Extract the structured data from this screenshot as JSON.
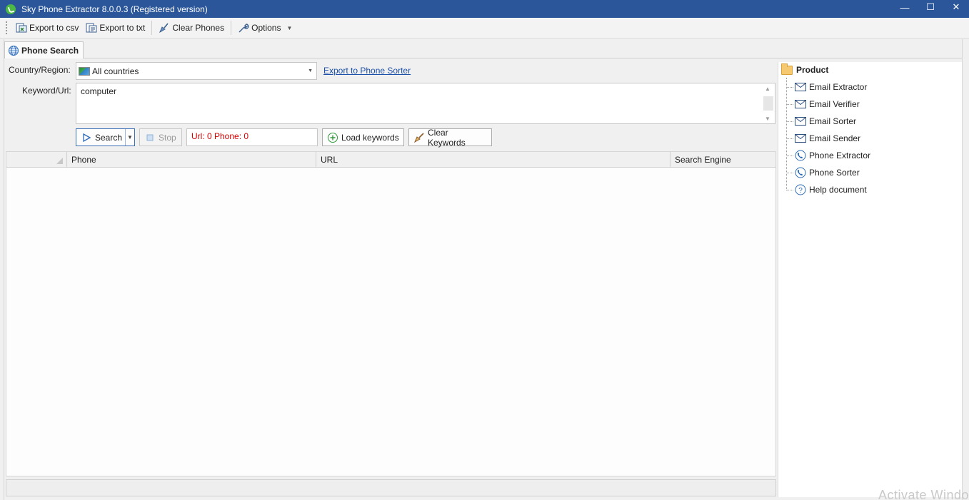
{
  "window": {
    "title": "Sky Phone Extractor 8.0.0.3 (Registered version)",
    "minimize": "—",
    "maximize": "☐",
    "close": "✕"
  },
  "toolbar": {
    "export_csv": "Export to csv",
    "export_txt": "Export to txt",
    "clear_phones": "Clear Phones",
    "options": "Options"
  },
  "tab": {
    "label": "Phone Search"
  },
  "form": {
    "country_label": "Country/Region:",
    "country_value": "All countries",
    "export_link": "Export to Phone Sorter",
    "keyword_label": "Keyword/Url:",
    "keyword_value": "computer",
    "search": "Search",
    "stop": "Stop",
    "status": "Url: 0 Phone: 0",
    "load_keywords": "Load keywords",
    "clear_keywords": "Clear Keywords"
  },
  "grid": {
    "columns": [
      "Phone",
      "URL",
      "Search Engine"
    ],
    "rows": []
  },
  "sidepanel": {
    "root": "Product",
    "items": [
      {
        "label": "Email Extractor",
        "icon": "mail-icon"
      },
      {
        "label": "Email Verifier",
        "icon": "mail-icon"
      },
      {
        "label": "Email Sorter",
        "icon": "mail-icon"
      },
      {
        "label": "Email Sender",
        "icon": "mail-icon"
      },
      {
        "label": "Phone Extractor",
        "icon": "phone-icon"
      },
      {
        "label": "Phone Sorter",
        "icon": "phone-icon"
      },
      {
        "label": "Help document",
        "icon": "help-icon"
      }
    ]
  },
  "watermark": "Activate Windo",
  "colors": {
    "titlebar": "#2b579a",
    "status_text": "#d40000",
    "link": "#1c4fa8"
  }
}
